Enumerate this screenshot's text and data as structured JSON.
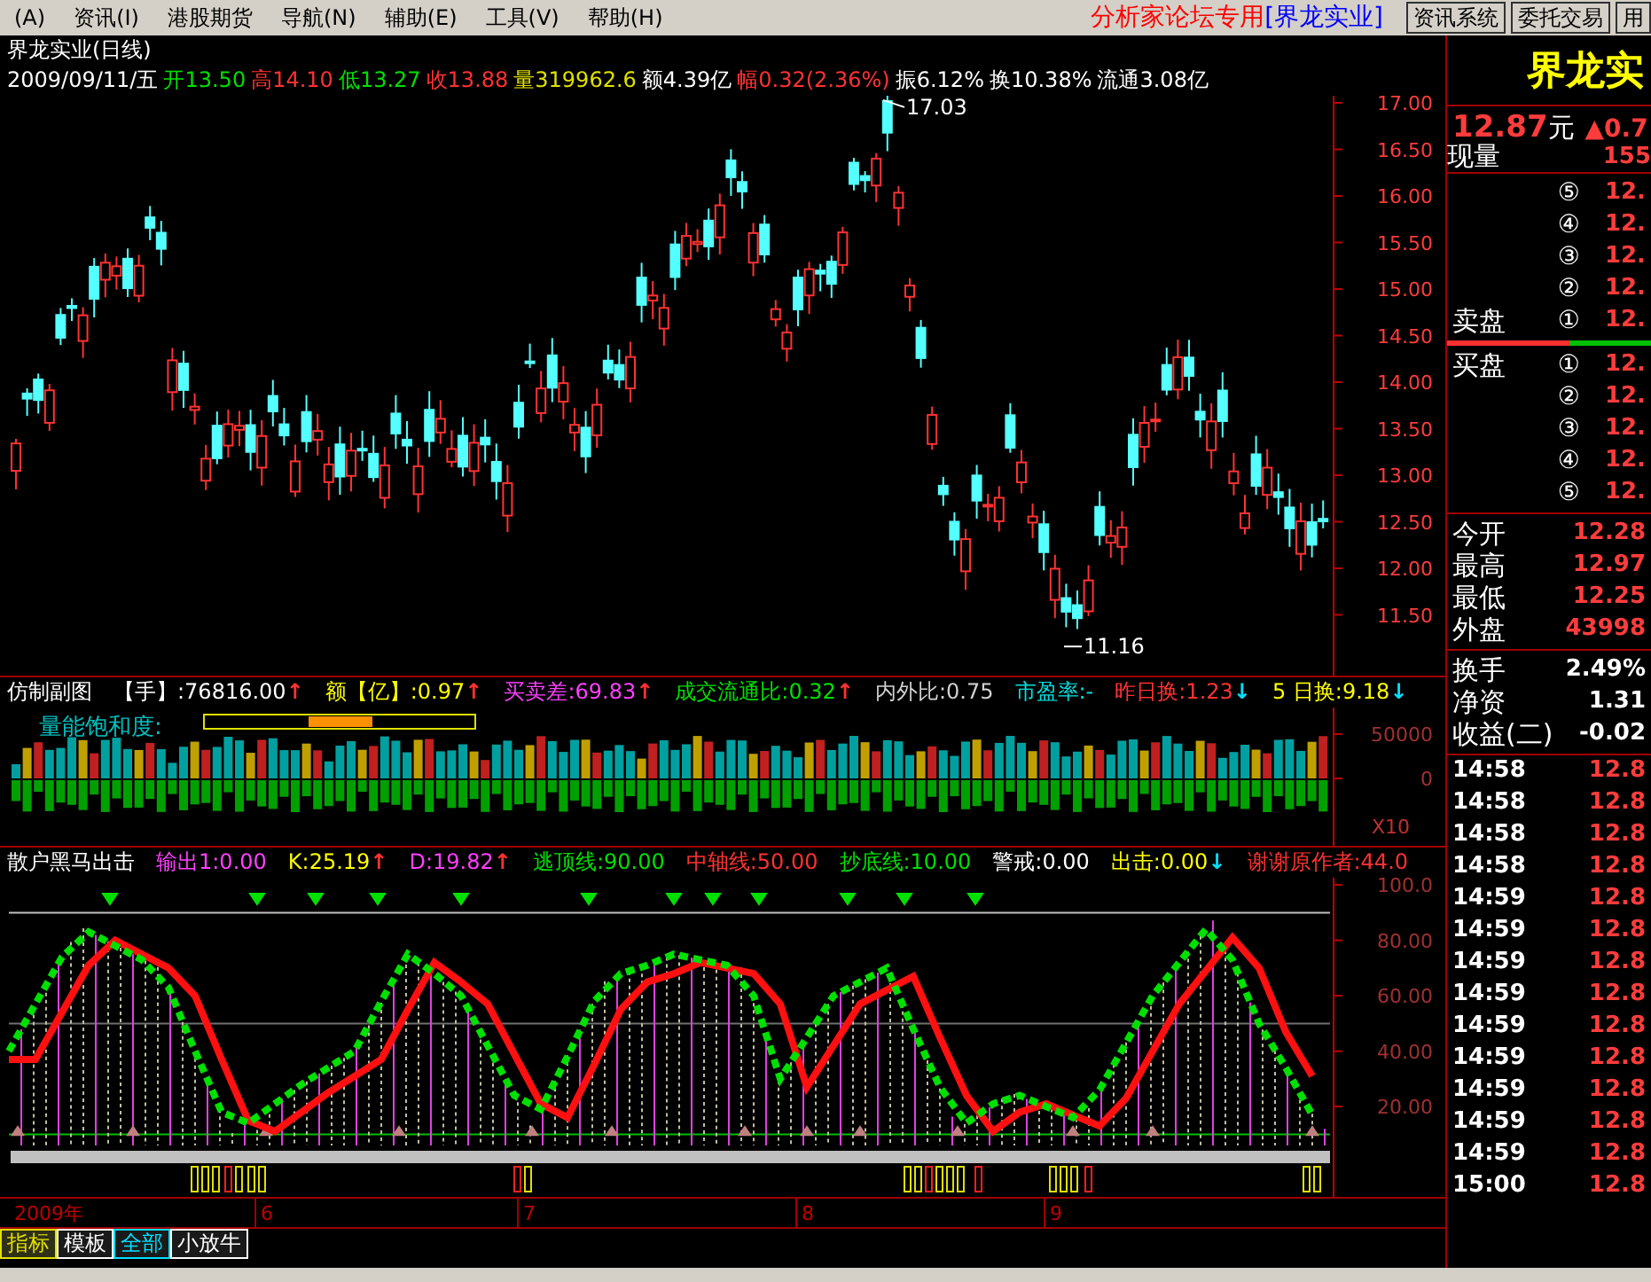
{
  "menu": [
    {
      "label": "(A)"
    },
    {
      "label": "资讯(I)"
    },
    {
      "label": "港股期货"
    },
    {
      "label": "导航(N)"
    },
    {
      "label": "辅助(E)"
    },
    {
      "label": "工具(V)"
    },
    {
      "label": "帮助(H)"
    }
  ],
  "banner": {
    "text": "分析家论坛专用",
    "stock": "[界龙实业]"
  },
  "toolbar_buttons": [
    "资讯系统",
    "委托交易",
    "用"
  ],
  "price_chart": {
    "title": "界龙实业(日线)",
    "info": [
      {
        "text": "2009/09/11/五",
        "color": "#ffffff"
      },
      {
        "text": "开13.50",
        "color": "#00e000"
      },
      {
        "text": "高14.10",
        "color": "#ff3232"
      },
      {
        "text": "低13.27",
        "color": "#00e000"
      },
      {
        "text": "收13.88",
        "color": "#ff3232"
      },
      {
        "text": "量319962.6",
        "color": "#e0e000"
      },
      {
        "text": "额4.39亿",
        "color": "#ffffff"
      },
      {
        "text": "幅0.32(2.36%)",
        "color": "#ff3232"
      },
      {
        "text": "振6.12%",
        "color": "#ffffff"
      },
      {
        "text": "换10.38%",
        "color": "#ffffff"
      },
      {
        "text": "流通3.08亿",
        "color": "#ffffff"
      }
    ],
    "price_axis": [
      "17.00",
      "16.50",
      "16.00",
      "15.50",
      "15.00",
      "14.50",
      "14.00",
      "13.50",
      "13.00",
      "12.50",
      "12.00",
      "11.50"
    ],
    "high_label": "17.03",
    "low_label": "11.16"
  },
  "indicator_1": {
    "name": "仿制副图",
    "readouts": [
      {
        "text": "【手】:76816.00",
        "color": "#ffffff",
        "arrow": {
          "symbol": "↑",
          "color": "#ff3232"
        }
      },
      {
        "text": "额【亿】:0.97",
        "color": "#ffff00",
        "arrow": {
          "symbol": "↑",
          "color": "#ff3232"
        }
      },
      {
        "text": "买卖差:69.83",
        "color": "#ff40ff",
        "arrow": {
          "symbol": "↑",
          "color": "#ff3232"
        }
      },
      {
        "text": "成交流通比:0.32",
        "color": "#00e000",
        "arrow": {
          "symbol": "↑",
          "color": "#ff3232"
        }
      },
      {
        "text": "内外比:0.75",
        "color": "#d0d0d0"
      },
      {
        "text": "市盈率:-",
        "color": "#00e0e0"
      },
      {
        "text": "昨日换:1.23",
        "color": "#ff3232",
        "arrow": {
          "symbol": "↓",
          "color": "#00e0ff"
        }
      },
      {
        "text": "5 日换:9.18",
        "color": "#ffff00",
        "arrow": {
          "symbol": "↓",
          "color": "#00e0ff"
        }
      }
    ],
    "gauge_label": "量能饱和度:",
    "axis": [
      "50000",
      "0"
    ],
    "scale": "X10"
  },
  "indicator_2": {
    "name": "散户黑马出击",
    "readouts": [
      {
        "text": "输出1:0.00",
        "color": "#ff40ff"
      },
      {
        "text": "K:25.19",
        "color": "#ffff00",
        "arrow": {
          "symbol": "↑",
          "color": "#ff3232"
        }
      },
      {
        "text": "D:19.82",
        "color": "#ff40ff",
        "arrow": {
          "symbol": "↑",
          "color": "#ff3232"
        }
      },
      {
        "text": "逃顶线:90.00",
        "color": "#00e000"
      },
      {
        "text": "中轴线:50.00",
        "color": "#ff3232"
      },
      {
        "text": "抄底线:10.00",
        "color": "#00e000"
      },
      {
        "text": "警戒:0.00",
        "color": "#ffffff"
      },
      {
        "text": "出击:0.00",
        "color": "#ffff00",
        "arrow": {
          "symbol": "↓",
          "color": "#00e0ff"
        }
      },
      {
        "text": "谢谢原作者:44.0",
        "color": "#ff3232"
      }
    ],
    "chart_data": {
      "type": "line",
      "ylim": [
        -12.6,
        102.6
      ],
      "yticks": [
        {
          "value": 100,
          "label": "100.0"
        },
        {
          "value": 80,
          "label": "80.00"
        },
        {
          "value": 60,
          "label": "60.00"
        },
        {
          "value": 40,
          "label": "40.00"
        },
        {
          "value": 20,
          "label": "20.00"
        }
      ],
      "series": [
        {
          "color": "#00e000",
          "line_style": "dashed",
          "values": [
            40,
            57,
            74,
            83,
            78,
            73,
            63,
            40,
            18,
            14,
            21,
            28,
            34,
            40,
            58,
            75,
            68,
            60,
            42,
            24,
            19,
            38,
            58,
            68,
            71,
            75,
            73,
            71,
            60,
            30,
            45,
            60,
            65,
            70,
            48,
            27,
            14,
            21,
            24,
            20,
            16,
            26,
            43,
            60,
            72,
            84,
            73,
            50,
            34,
            17
          ]
        },
        {
          "color": "#ff1010",
          "line_style": "solid",
          "values": [
            37,
            37,
            54,
            71,
            80,
            75,
            70,
            60,
            37,
            15,
            11,
            18,
            25,
            31,
            37,
            55,
            72,
            65,
            57,
            39,
            21,
            16,
            35,
            55,
            65,
            68,
            72,
            70,
            68,
            57,
            27,
            42,
            57,
            62,
            67,
            45,
            24,
            11,
            18,
            21,
            17,
            13,
            23,
            40,
            57,
            69,
            81,
            70,
            47,
            31
          ]
        }
      ]
    }
  },
  "date_axis": [
    "2009年",
    "6",
    "7",
    "8",
    "9"
  ],
  "quote": {
    "name": "界龙实",
    "price": "12.87",
    "unit": "元",
    "change": "▲0.7",
    "current_volume": {
      "label": "现量",
      "value": "155"
    },
    "sell": [
      {
        "level": "⑤",
        "price": "12."
      },
      {
        "level": "④",
        "price": "12."
      },
      {
        "level": "③",
        "price": "12."
      },
      {
        "level": "②",
        "price": "12."
      },
      {
        "label": "卖盘",
        "level": "①",
        "price": "12."
      }
    ],
    "buy": [
      {
        "label": "买盘",
        "level": "①",
        "price": "12."
      },
      {
        "level": "②",
        "price": "12."
      },
      {
        "level": "③",
        "price": "12."
      },
      {
        "level": "④",
        "price": "12."
      },
      {
        "level": "⑤",
        "price": "12."
      }
    ],
    "stats": [
      {
        "label": "今开",
        "value": "12.28"
      },
      {
        "label": "最高",
        "value": "12.97"
      },
      {
        "label": "最低",
        "value": "12.25"
      },
      {
        "label": "外盘",
        "value": "43998"
      }
    ],
    "stats_2": [
      {
        "label": "换手",
        "value": "2.49%"
      },
      {
        "label": "净资",
        "value": "1.31"
      },
      {
        "label": "收益(二)",
        "value": "-0.02"
      }
    ],
    "ticks": [
      {
        "time": "14:58",
        "price": "12.8"
      },
      {
        "time": "14:58",
        "price": "12.8"
      },
      {
        "time": "14:58",
        "price": "12.8"
      },
      {
        "time": "14:58",
        "price": "12.8"
      },
      {
        "time": "14:59",
        "price": "12.8"
      },
      {
        "time": "14:59",
        "price": "12.8"
      },
      {
        "time": "14:59",
        "price": "12.8"
      },
      {
        "time": "14:59",
        "price": "12.8"
      },
      {
        "time": "14:59",
        "price": "12.8"
      },
      {
        "time": "14:59",
        "price": "12.8"
      },
      {
        "time": "14:59",
        "price": "12.8"
      },
      {
        "time": "14:59",
        "price": "12.8"
      },
      {
        "time": "14:59",
        "price": "12.8"
      },
      {
        "time": "15:00",
        "price": "12.8"
      }
    ]
  },
  "bottom_tabs": [
    {
      "label": "指标",
      "selected": true,
      "color": "#e0e000"
    },
    {
      "label": "模板",
      "selected": false,
      "color": "#ffffff"
    },
    {
      "label": "全部",
      "selected": false,
      "color": "#00e0ff"
    },
    {
      "label": "小放牛",
      "selected": false,
      "color": "#ffffff"
    }
  ]
}
